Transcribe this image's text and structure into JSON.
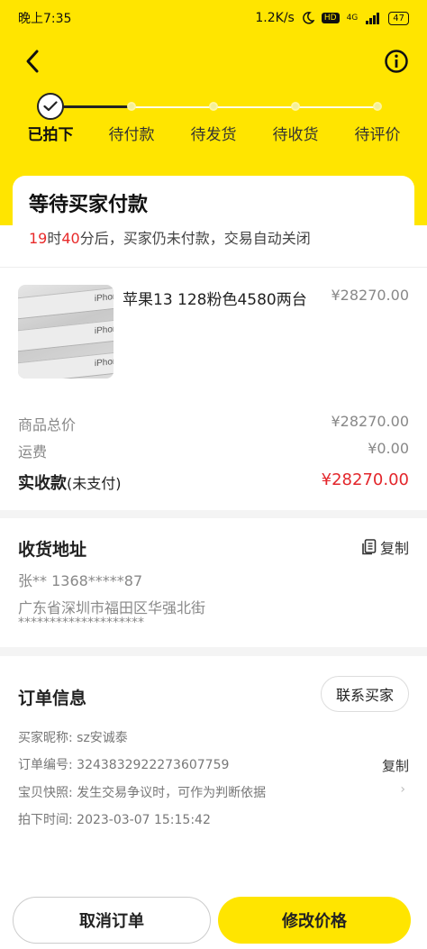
{
  "status_bar": {
    "time": "晚上7:35",
    "network_speed": "1.2K/s",
    "hd_badge": "HD",
    "signal": "4G",
    "battery": "47"
  },
  "steps": [
    {
      "label": "已拍下",
      "state": "done"
    },
    {
      "label": "待付款",
      "state": "pending"
    },
    {
      "label": "待发货",
      "state": "pending"
    },
    {
      "label": "待收货",
      "state": "pending"
    },
    {
      "label": "待评价",
      "state": "pending"
    }
  ],
  "wait_card": {
    "title": "等待买家付款",
    "hours": "19",
    "hours_unit": "时",
    "minutes": "40",
    "tail": "分后，买家仍未付款，交易自动关闭"
  },
  "product": {
    "name": "苹果13 128粉色4580两台",
    "price": "¥28270.00",
    "thumb_texts": [
      "iPhone",
      "iPhone",
      "iPhone"
    ]
  },
  "summary": {
    "goods_total_label": "商品总价",
    "goods_total_value": "¥28270.00",
    "shipping_label": "运费",
    "shipping_value": "¥0.00",
    "actual_label": "实收款",
    "actual_note": "(未支付)",
    "actual_value": "¥28270.00"
  },
  "address": {
    "title": "收货地址",
    "copy_label": "复制",
    "contact": "张** 1368*****87",
    "region": "广东省深圳市福田区华强北街",
    "detail": "********************"
  },
  "order": {
    "title": "订单信息",
    "contact_buyer": "联系买家",
    "buyer_nick": "买家昵称: sz安诚泰",
    "order_no": "订单编号: 3243832922273607759",
    "order_copy": "复制",
    "snapshot": "宝贝快照: 发生交易争议时，可作为判断依据",
    "snapshot_chevron": "›",
    "placed_time": "拍下时间: 2023-03-07 15:15:42"
  },
  "actions": {
    "cancel": "取消订单",
    "modify_price": "修改价格"
  },
  "colors": {
    "brand_yellow": "#ffe500",
    "price_red": "#e3262b"
  }
}
